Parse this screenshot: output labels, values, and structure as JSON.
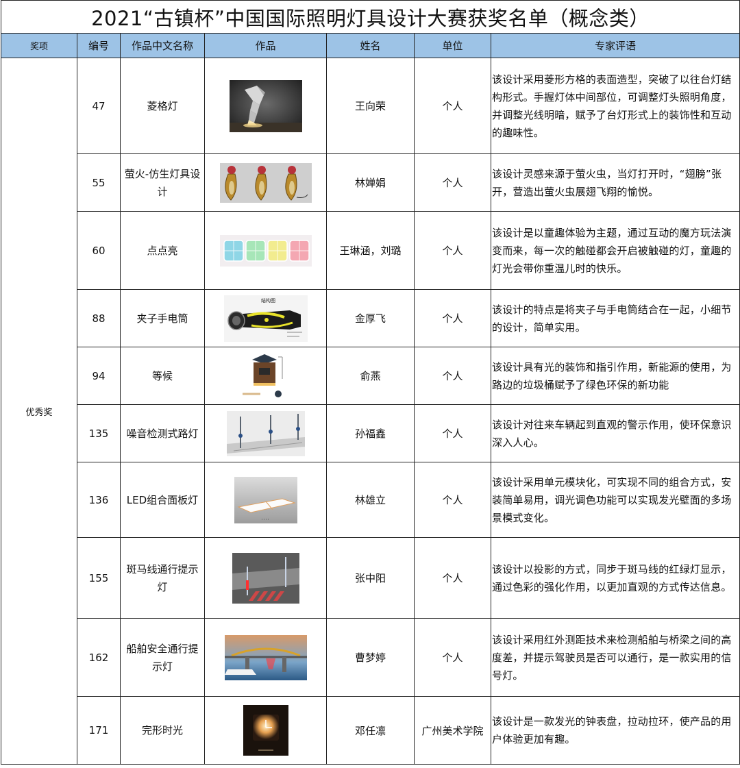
{
  "title": "2021“古镇杯”中国国际照明灯具设计大赛获奖名单（概念类）",
  "columns": [
    "奖项",
    "编号",
    "作品中文名称",
    "作品",
    "姓名",
    "单位",
    "专家评语"
  ],
  "award": "优秀奖",
  "rows": [
    {
      "no": "47",
      "work_name": "菱格灯",
      "author": "王向荣",
      "unit": "个人",
      "comment": "该设计采用菱形方格的表面造型，突破了以往台灯结构形式。手握灯体中间部位，可调整灯头照明角度，并调整光线明暗，赋予了台灯形式上的装饰性和互动的趣味性。"
    },
    {
      "no": "55",
      "work_name": "萤火-仿生灯具设计",
      "author": "林婵娟",
      "unit": "个人",
      "comment": "该设计灵感来源于萤火虫，当灯打开时，“翅膀”张开，营造出萤火虫展翅飞翔的愉悦。"
    },
    {
      "no": "60",
      "work_name": "点点亮",
      "author": "王琳涵，刘璐",
      "unit": "个人",
      "comment": "该设计是以童趣体验为主题，通过互动的魔方玩法演变而来，每一次的触碰都会开启被触碰的灯，童趣的灯光会带你重温儿时的快乐。"
    },
    {
      "no": "88",
      "work_name": "夹子手电筒",
      "author": "金厚飞",
      "unit": "个人",
      "comment": "该设计的特点是将夹子与手电筒结合在一起，小细节的设计，简单实用。",
      "image_label": "结构图"
    },
    {
      "no": "94",
      "work_name": "等候",
      "author": "俞燕",
      "unit": "个人",
      "comment": "该设计具有光的装饰和指引作用，新能源的使用，为路边的垃圾桶赋予了绿色环保的新功能"
    },
    {
      "no": "135",
      "work_name": "噪音检测式路灯",
      "author": "孙福鑫",
      "unit": "个人",
      "comment": "该设计对往来车辆起到直观的警示作用，使环保意识深入人心。"
    },
    {
      "no": "136",
      "work_name": "LED组合面板灯",
      "author": "林雄立",
      "unit": "个人",
      "comment": "该设计采用单元模块化，可实现不同的组合方式，安装简单易用，调光调色功能可以实现发光壁面的多场景模式变化。"
    },
    {
      "no": "155",
      "work_name": "斑马线通行提示灯",
      "author": "张中阳",
      "unit": "个人",
      "comment": "该设计以投影的方式，同步于斑马线的红绿灯显示，通过色彩的强化作用，以更加直观的方式传达信息。"
    },
    {
      "no": "162",
      "work_name": "船舶安全通行提示灯",
      "author": "曹梦婷",
      "unit": "个人",
      "comment": "该设计采用红外测距技术来检测船舶与桥梁之间的高度差，并提示驾驶员是否可以通行，是一款实用的信号灯。"
    },
    {
      "no": "171",
      "work_name": "完形时光",
      "author": "邓任凛",
      "unit": "广州美术学院",
      "comment": "该设计是一款发光的钟表盘，拉动拉环，使产品的用户体验更加有趣。"
    }
  ],
  "colors": {
    "header_bg": "#9dc3e6",
    "border": "#222222"
  }
}
